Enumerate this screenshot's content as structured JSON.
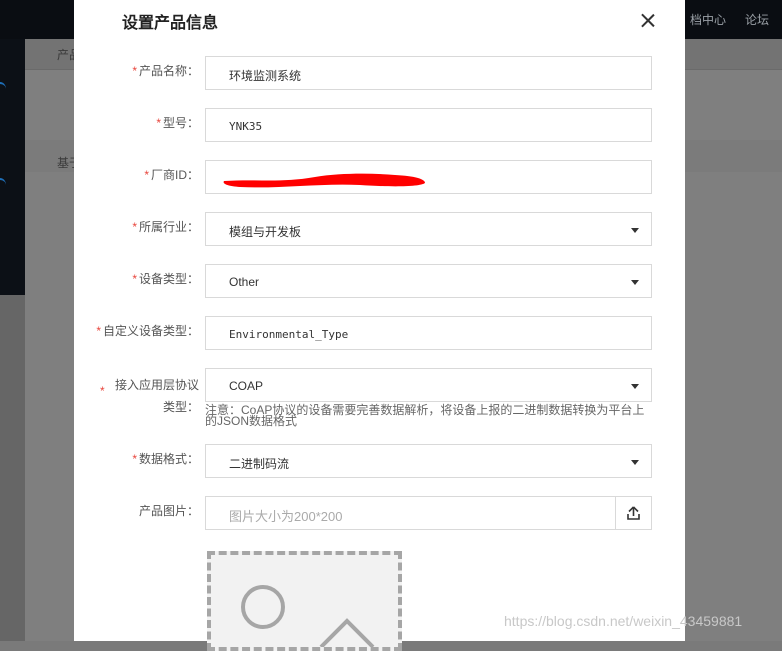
{
  "background": {
    "top_nav": [
      "档中心",
      "论坛"
    ],
    "tab_label_top": "产品",
    "tab_label_section": "基于"
  },
  "modal": {
    "title": "设置产品信息",
    "fields": {
      "product_name": {
        "label": "产品名称：",
        "value": "环境监测系统",
        "required": true
      },
      "model": {
        "label": "型号：",
        "value": "YNK35",
        "required": true
      },
      "vendor_id": {
        "label": "厂商ID：",
        "value": "",
        "required": true
      },
      "industry": {
        "label": "所属行业：",
        "value": "模组与开发板",
        "required": true
      },
      "device_type": {
        "label": "设备类型：",
        "value": "Other",
        "required": true
      },
      "custom_device_type": {
        "label": "自定义设备类型：",
        "value": "Environmental_Type",
        "required": true
      },
      "protocol": {
        "label_line1": "接入应用层协议",
        "label_line2": "类型：",
        "value": "COAP",
        "required": true,
        "note": "注意：CoAP协议的设备需要完善数据解析，将设备上报的二进制数据转换为平台上的JSON数据格式"
      },
      "data_format": {
        "label": "数据格式：",
        "value": "二进制码流",
        "required": true
      },
      "product_image": {
        "label": "产品图片：",
        "placeholder": "图片大小为200*200",
        "required": false
      }
    },
    "required_mark": "*"
  },
  "watermark": "https://blog.csdn.net/weixin_43459881",
  "colors": {
    "required": "#e8453c",
    "redaction": "#ff0000",
    "overlay": "#7f7f7f"
  }
}
